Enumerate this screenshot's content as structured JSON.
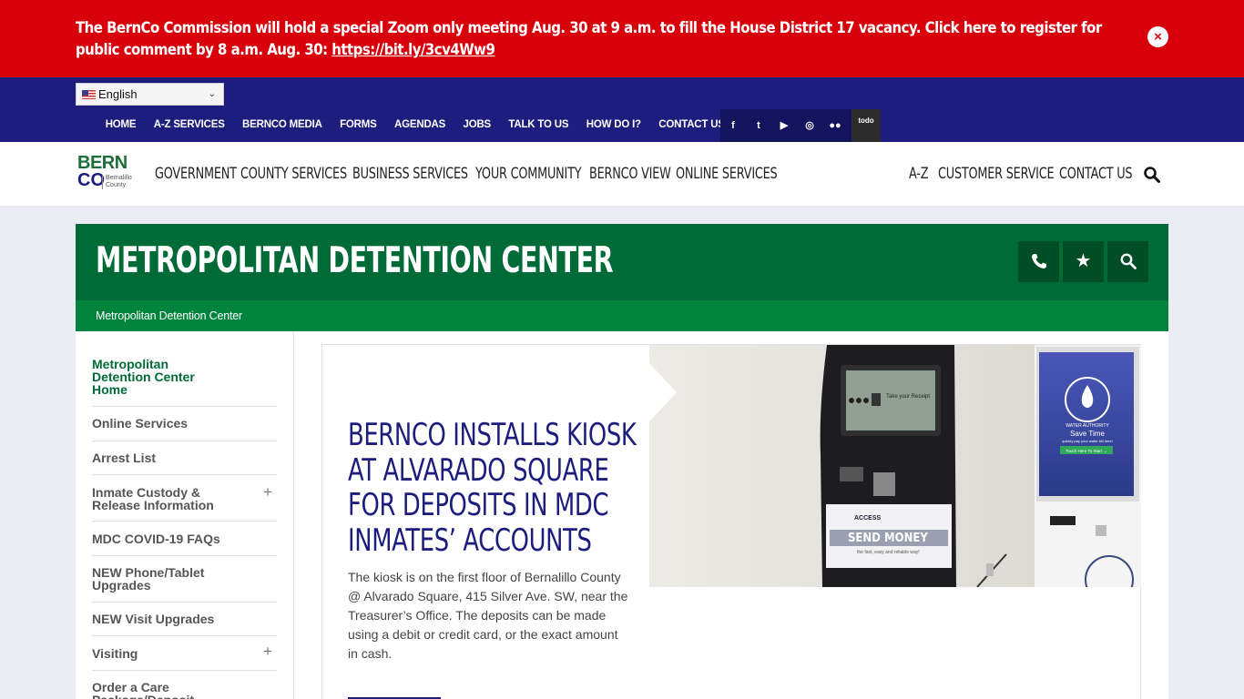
{
  "alert": {
    "text": "The BernCo Commission will hold a special Zoom only meeting Aug. 30 at 9 a.m. to fill the House District 17 vacancy. Click here to register for public comment by 8 a.m. Aug. 30: ",
    "link": "https://bit.ly/3cv4Ww9",
    "close": "×"
  },
  "language": {
    "selected": "English"
  },
  "topnav": [
    "HOME",
    "A-Z SERVICES",
    "BERNCO MEDIA",
    "FORMS",
    "AGENDAS",
    "JOBS",
    "TALK TO US",
    "HOW DO I?",
    "CONTACT US"
  ],
  "social": [
    "f",
    "t",
    "▶",
    "◎",
    "●●",
    "todo"
  ],
  "logo": {
    "line1": "BERN",
    "line2": "CO",
    "sub1": "Bernalillo",
    "sub2": "County"
  },
  "mainnav": [
    "GOVERNMENT",
    "COUNTY SERVICES",
    "BUSINESS SERVICES",
    "YOUR COMMUNITY",
    "BERNCO VIEW",
    "ONLINE SERVICES"
  ],
  "rightnav": [
    "A-Z",
    "CUSTOMER SERVICE",
    "CONTACT US"
  ],
  "dept": {
    "title": "METROPOLITAN DETENTION CENTER",
    "breadcrumb": "Metropolitan Detention Center"
  },
  "sidebar": [
    {
      "label": "Metropolitan Detention Center Home",
      "active": true,
      "expand": ""
    },
    {
      "label": "Online Services",
      "expand": ""
    },
    {
      "label": "Arrest List",
      "expand": ""
    },
    {
      "label": "Inmate Custody & Release Information",
      "expand": "+"
    },
    {
      "label": "MDC COVID-19 FAQs",
      "expand": ""
    },
    {
      "label": "NEW Phone/Tablet Upgrades",
      "expand": ""
    },
    {
      "label": "NEW Visit Upgrades",
      "expand": ""
    },
    {
      "label": "Visiting",
      "expand": "+"
    },
    {
      "label": "Order a Care Package/Deposit",
      "expand": ""
    }
  ],
  "feature": {
    "title": "BERNCO INSTALLS KIOSK AT ALVARADO SQUARE FOR DEPOSITS IN MDC INMATES’ ACCOUNTS",
    "body": "The kiosk is on the first floor of Bernalillo County @ Alvarado Square, 415 Silver Ave. SW, near the Treasurer’s Office. The deposits can be made using a debit or credit card, or the exact amount in cash.",
    "image": {
      "screen_text": "Take your Receipt",
      "brand": "ACCESS",
      "sign": "SEND MONEY",
      "sign_sub": "the fast, easy and reliable way!",
      "water_logo": "WATER AUTHORITY",
      "save_time": "Save Time",
      "save_sub": "quickly pay your water bill here!",
      "touch": "Touch Here To Start →"
    }
  },
  "colors": {
    "alert": "#d7000b",
    "navy": "#1c1d7d",
    "green": "#006b37",
    "green_light": "#00843d"
  }
}
